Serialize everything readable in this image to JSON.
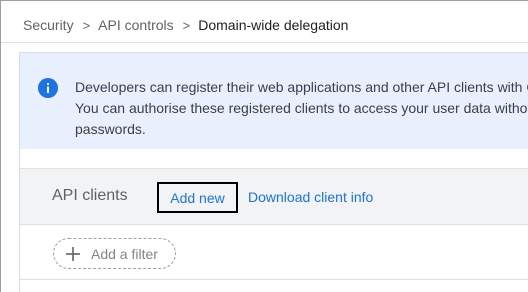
{
  "breadcrumb": {
    "items": [
      "Security",
      "API controls"
    ],
    "separator": ">",
    "current": "Domain-wide delegation"
  },
  "banner": {
    "icon": "info-icon",
    "lines": [
      "Developers can register their web applications and other API clients with G",
      "You can authorise these registered clients to access your user data withou",
      "passwords."
    ]
  },
  "api_clients": {
    "title": "API clients",
    "add_new_label": "Add new",
    "download_label": "Download client info"
  },
  "filter": {
    "icon": "plus-icon",
    "label": "Add a filter"
  },
  "colors": {
    "accent": "#1a73e8",
    "banner_bg": "#e8f0fe",
    "toolbar_bg": "#f1f3f4"
  }
}
